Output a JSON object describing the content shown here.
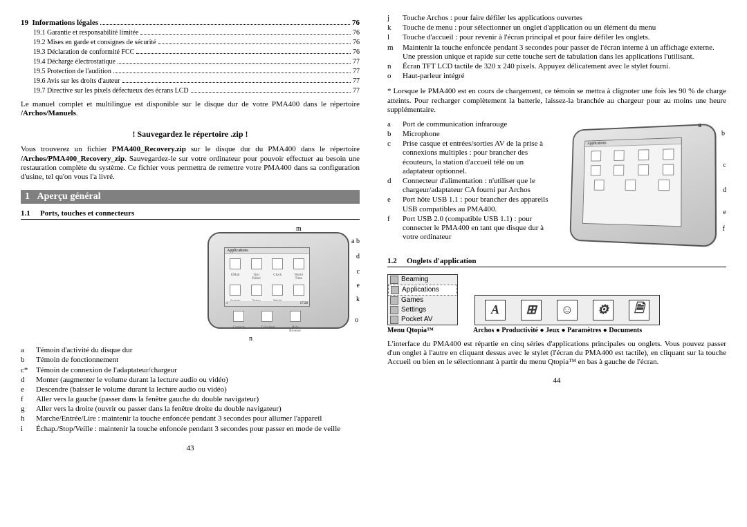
{
  "left": {
    "toc_main": {
      "num": "19",
      "title": "Informations légales",
      "page": "76"
    },
    "toc_subs": [
      {
        "num": "19.1",
        "title": "Garantie et responsabilité limitée",
        "page": "76"
      },
      {
        "num": "19.2",
        "title": "Mises en garde et consignes de sécurité",
        "page": "76"
      },
      {
        "num": "19.3",
        "title": "Déclaration de conformité FCC",
        "page": "76"
      },
      {
        "num": "19.4",
        "title": "Décharge électrostatique",
        "page": "77"
      },
      {
        "num": "19.5",
        "title": "Protection de l'audition",
        "page": "77"
      },
      {
        "num": "19.6",
        "title": "Avis sur les droits d'auteur",
        "page": "77"
      },
      {
        "num": "19.7",
        "title": "Directive sur les pixels défectueux des écrans LCD",
        "page": "77"
      }
    ],
    "manual_para_a": "Le manuel complet et multilingue est disponible sur le disque dur de votre PMA400 dans le répertoire ",
    "manual_para_b": "/Archos/Manuels",
    "save_heading": "! Sauvegardez le répertoire .zip !",
    "save_para_a": "Vous trouverez un fichier ",
    "save_para_b": "PMA400_Recovery.zip",
    "save_para_c": " sur le disque dur du PMA400 dans le répertoire ",
    "save_para_d": "/Archos/PMA400_Recovery_zip",
    "save_para_e": ". Sauvegardez-le sur votre ordinateur pour pouvoir effectuer au besoin une restauration complète du système. Ce fichier vous permettra de remettre votre PMA400 dans sa configuration d'usine, tel qu'on vous l'a livré.",
    "section1_num": "1",
    "section1_title": "Aperçu général",
    "sub11_num": "1.1",
    "sub11_title": "Ports, touches et connecteurs",
    "keylist_left": [
      {
        "k": "a",
        "t": "Témoin d'activité du disque dur"
      },
      {
        "k": "b",
        "t": "Témoin de fonctionnement"
      },
      {
        "k": "c*",
        "t": "Témoin de connexion de l'adaptateur/chargeur"
      },
      {
        "k": "d",
        "t": "Monter (augmenter le volume durant la lecture audio ou vidéo)"
      },
      {
        "k": "e",
        "t": "Descendre (baisser le volume durant la lecture audio ou vidéo)"
      },
      {
        "k": "f",
        "t": "Aller vers la gauche (passer dans la fenêtre gauche du double navigateur)"
      },
      {
        "k": "g",
        "t": "Aller vers la droite (ouvrir ou passer dans la fenêtre droite du double navigateur)"
      },
      {
        "k": "h",
        "t": "Marche/Entrée/Lire : maintenir la touche enfoncée pendant 3 secondes pour allumer l'appareil"
      },
      {
        "k": "i",
        "t": "Échap./Stop/Veille : maintenir la touche enfoncée pendant 3 secondes pour passer en mode de veille"
      }
    ],
    "device_labels": [
      "m",
      "a",
      "b",
      "d",
      "c",
      "e",
      "k",
      "o",
      "n"
    ],
    "pagenum": "43"
  },
  "right": {
    "keylist_top": [
      {
        "k": "j",
        "t": "Touche Archos : pour faire défiler les applications ouvertes"
      },
      {
        "k": "k",
        "t": "Touche de menu : pour sélectionner un onglet d'application ou un élément du menu"
      },
      {
        "k": "l",
        "t": "Touche d'accueil : pour revenir à l'écran principal et pour faire défiler les onglets."
      },
      {
        "k": "m",
        "t": "Maintenir la touche enfoncée pendant 3 secondes pour passer de l'écran interne à un affichage externe. Une pression unique et rapide sur cette touche sert de tabulation dans les applications l'utilisant."
      },
      {
        "k": "n",
        "t": "Écran TFT LCD tactile de 320 x 240 pixels. Appuyez délicatement avec le stylet fourni."
      },
      {
        "k": "o",
        "t": "Haut-parleur intégré"
      }
    ],
    "star_para": "* Lorsque le PMA400 est en cours de chargement, ce témoin se mettra à clignoter une fois les 90 % de charge atteints. Pour recharger complètement la batterie, laissez-la branchée au chargeur pour au moins une heure supplémentaire.",
    "keylist_af": [
      {
        "k": "a",
        "t": "Port de communication infrarouge"
      },
      {
        "k": "b",
        "t": "Microphone"
      },
      {
        "k": "c",
        "t": "Prise casque et entrées/sorties AV de la prise à connexions multiples : pour brancher des écouteurs, la station d'accueil télé ou un adaptateur optionnel."
      },
      {
        "k": "d",
        "t": "Connecteur d'alimentation : n'utiliser que le chargeur/adaptateur CA fourni par Archos"
      },
      {
        "k": "e",
        "t": "Port hôte USB 1.1 : pour brancher des appareils USB compatibles au PMA400."
      },
      {
        "k": "f",
        "t": "Port USB 2.0 (compatible USB 1.1) : pour connecter le PMA400 en tant que disque dur à votre ordinateur"
      }
    ],
    "device_labels": [
      "a",
      "b",
      "c",
      "d",
      "e",
      "f"
    ],
    "sub12_num": "1.2",
    "sub12_title": "Onglets d'application",
    "menu_items": [
      "Beaming",
      "Applications",
      "Games",
      "Settings",
      "Pocket AV"
    ],
    "caption_left": "Menu Qtopia™",
    "caption_right": "Archos ● Productivité ● Jeux ● Paramètres ● Documents",
    "bottom_para": "L'interface du PMA400 est répartie en cinq séries d'applications principales ou onglets. Vous pouvez passer d'un onglet à l'autre en cliquant dessus avec le stylet (l'écran du PMA400 est tactile), en cliquant sur la touche Accueil ou bien en le sélectionnant à partir du menu Qtopia™ en bas à gauche de l'écran.",
    "pagenum": "44"
  },
  "icons": {
    "strip": [
      "A",
      "⊞",
      "☺",
      "⚙",
      "🗎"
    ]
  }
}
